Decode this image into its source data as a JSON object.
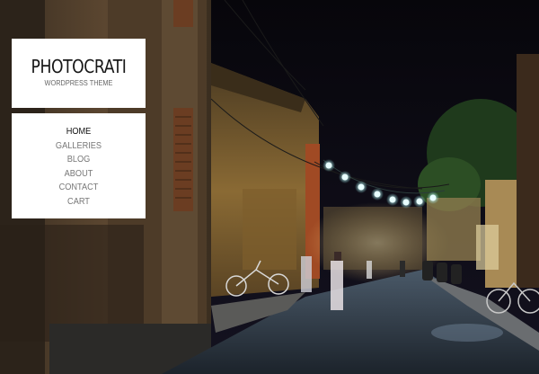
{
  "site": {
    "title": "PHOTOCRATI",
    "subtitle": "WORDPRESS THEME"
  },
  "nav": {
    "items": [
      {
        "label": "HOME",
        "active": true
      },
      {
        "label": "GALLERIES",
        "active": false
      },
      {
        "label": "BLOG",
        "active": false
      },
      {
        "label": "ABOUT",
        "active": false
      },
      {
        "label": "CONTACT",
        "active": false
      },
      {
        "label": "CART",
        "active": false
      }
    ]
  },
  "background": {
    "subject": "night street with lanterns",
    "colors": {
      "sky": "#0a0812",
      "wall_warm": "#7a5a2e",
      "lantern": "#dfffff",
      "road": "#3a4a5a"
    }
  }
}
